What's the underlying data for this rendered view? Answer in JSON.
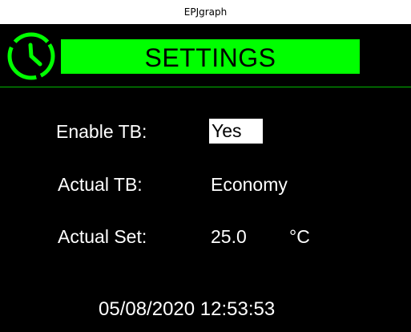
{
  "window": {
    "title": "EPJgraph"
  },
  "header": {
    "title": "SETTINGS",
    "icon": "clock-icon",
    "banner_color": "#00ff00"
  },
  "settings": {
    "rows": [
      {
        "label": "Enable TB:",
        "value": "Yes"
      },
      {
        "label": "Actual TB:",
        "value": "Economy"
      },
      {
        "label": "Actual Set:",
        "value": "25.0",
        "unit": "°C"
      }
    ]
  },
  "footer": {
    "datetime": "05/08/2020 12:53:53"
  },
  "colors": {
    "screen_background": "#000000",
    "accent_green": "#00ff00",
    "text": "#ffffff"
  }
}
